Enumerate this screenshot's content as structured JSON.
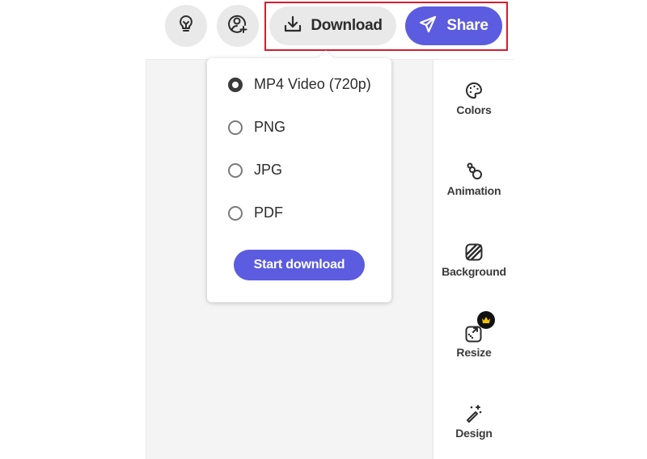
{
  "toolbar": {
    "ideas_icon": "lightbulb-icon",
    "invite_icon": "add-user-icon",
    "download_label": "Download",
    "download_icon": "download-icon",
    "share_label": "Share",
    "share_icon": "send-icon"
  },
  "download_menu": {
    "options": [
      {
        "label": "MP4 Video (720p)",
        "selected": true
      },
      {
        "label": "PNG",
        "selected": false
      },
      {
        "label": "JPG",
        "selected": false
      },
      {
        "label": "PDF",
        "selected": false
      }
    ],
    "start_label": "Start download"
  },
  "sidebar": {
    "items": [
      {
        "label": "Colors",
        "icon": "palette-icon"
      },
      {
        "label": "Animation",
        "icon": "animation-icon"
      },
      {
        "label": "Background",
        "icon": "background-icon"
      },
      {
        "label": "Resize",
        "icon": "resize-icon",
        "premium": true
      },
      {
        "label": "Design",
        "icon": "magic-wand-icon"
      }
    ]
  },
  "colors": {
    "accent": "#5c5ce0",
    "highlight_border": "#d01f2e",
    "button_gray": "#e9e9e9",
    "canvas_bg": "#f4f4f4",
    "crown": "#f5c400"
  }
}
